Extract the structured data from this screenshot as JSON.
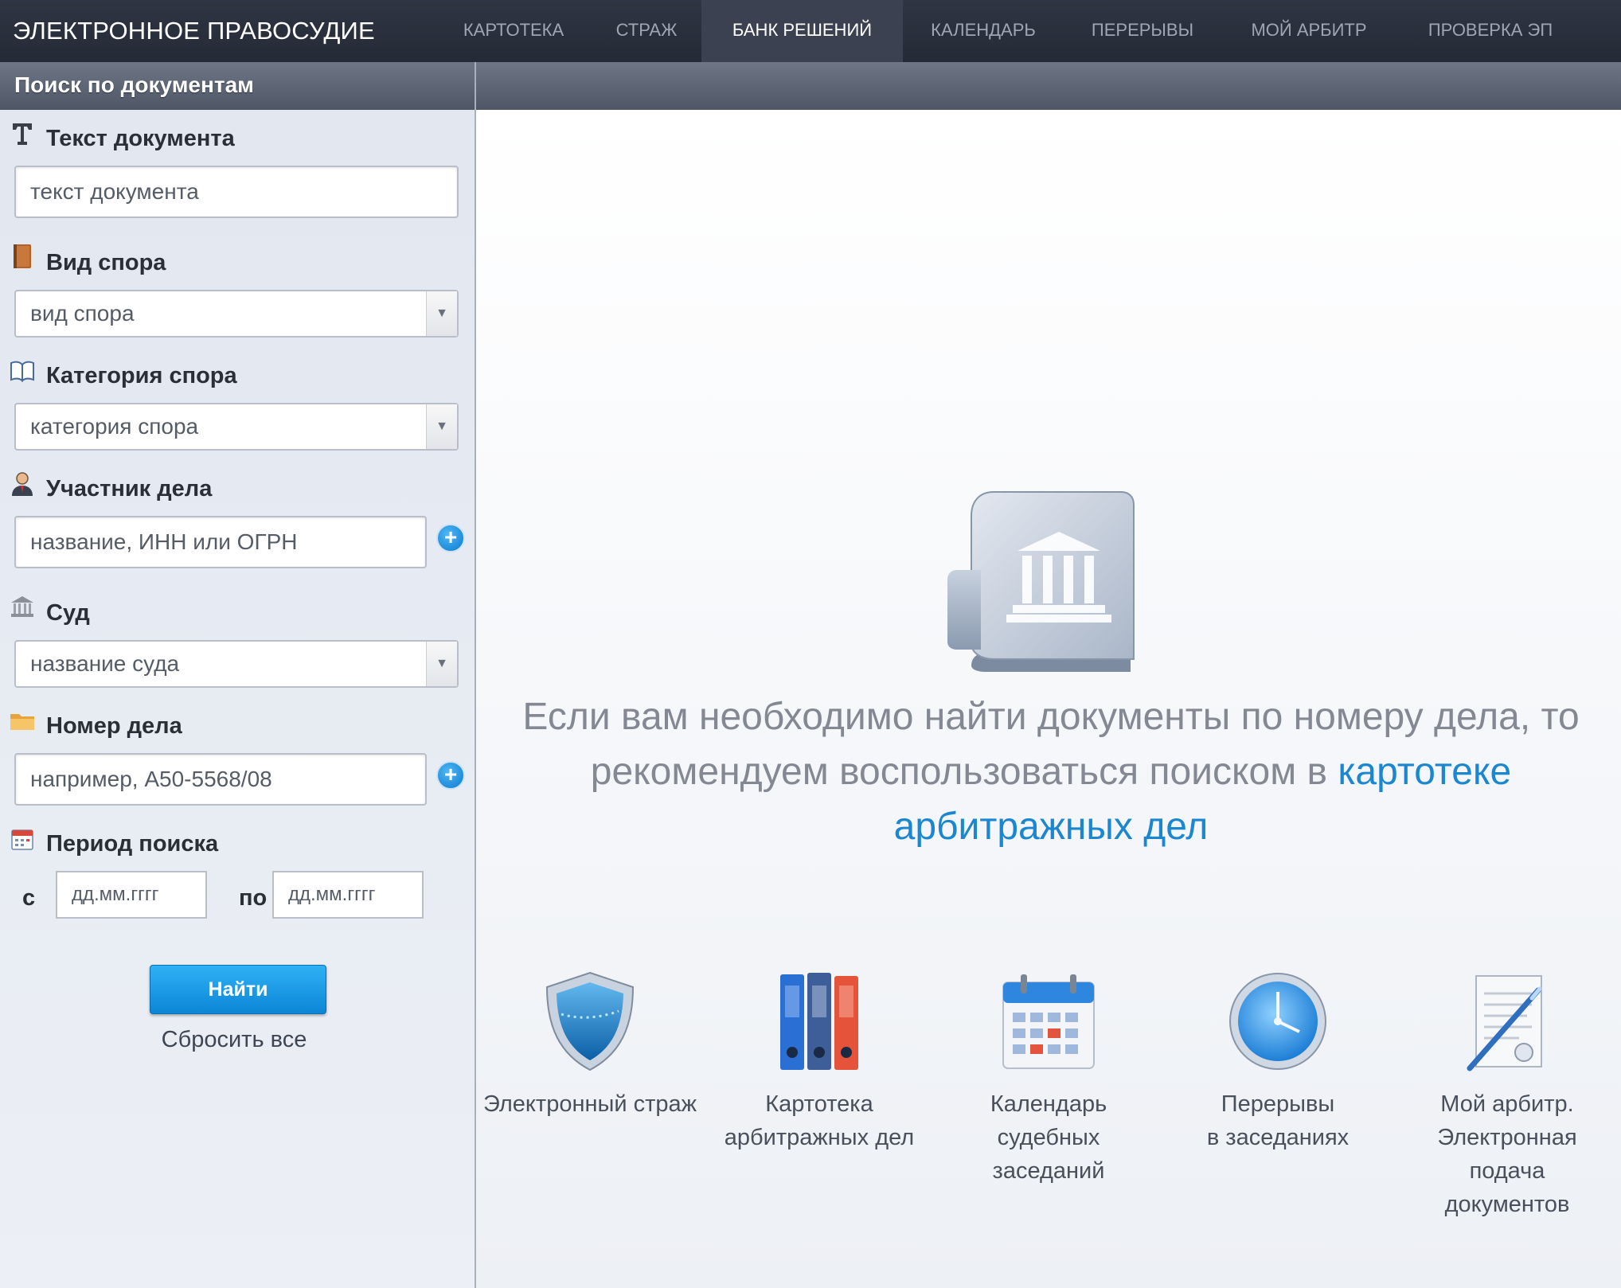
{
  "brand": "ЭЛЕКТРОННОЕ ПРАВОСУДИЕ",
  "nav": {
    "items": [
      "КАРТОТЕКА",
      "СТРАЖ",
      "БАНК РЕШЕНИЙ",
      "КАЛЕНДАРЬ",
      "ПЕРЕРЫВЫ",
      "МОЙ АРБИТР",
      "ПРОВЕРКА ЭП"
    ],
    "active": "БАНК РЕШЕНИЙ"
  },
  "sidebar": {
    "title": "Поиск по документам",
    "doc_text": {
      "label": "Текст документа",
      "placeholder": "текст документа",
      "icon": "text-t-icon"
    },
    "dispute_type": {
      "label": "Вид спора",
      "value": "вид спора",
      "icon": "book-icon"
    },
    "dispute_category": {
      "label": "Категория спора",
      "value": "категория спора",
      "icon": "open-book-icon"
    },
    "participant": {
      "label": "Участник дела",
      "placeholder": "название, ИНН или ОГРН",
      "icon": "user-icon"
    },
    "court": {
      "label": "Суд",
      "value": "название суда",
      "icon": "courthouse-icon"
    },
    "case_number": {
      "label": "Номер дела",
      "placeholder": "например, А50-5568/08",
      "icon": "folder-icon"
    },
    "period": {
      "label": "Период поиска",
      "from_label": "с",
      "to_label": "по",
      "from_placeholder": "дд.мм.гггг",
      "to_placeholder": "дд.мм.гггг",
      "icon": "calendar-icon"
    },
    "find_button": "Найти",
    "reset_link": "Сбросить все"
  },
  "main": {
    "hero_text_before": "Если вам необходимо найти документы по номеру дела, то рекомендуем воспользоваться поиском в ",
    "hero_link": "картотеке арбитражных дел",
    "tiles": [
      {
        "icon": "shield-icon",
        "line1": "Электронный страж",
        "line2": "",
        "line3": "",
        "line4": ""
      },
      {
        "icon": "binders-icon",
        "line1": "Картотека",
        "line2": "арбитражных дел",
        "line3": "",
        "line4": ""
      },
      {
        "icon": "calendar-icon",
        "line1": "Календарь",
        "line2": "судебных",
        "line3": "заседаний",
        "line4": ""
      },
      {
        "icon": "clock-icon",
        "line1": "Перерывы",
        "line2": "в заседаниях",
        "line3": "",
        "line4": ""
      },
      {
        "icon": "document-pen-icon",
        "line1": "Мой арбитр.",
        "line2": "Электронная",
        "line3": "подача",
        "line4": "документов"
      }
    ]
  },
  "colors": {
    "topbar": "#262c38",
    "link": "#1a87d0",
    "button": "#0b86d6"
  }
}
